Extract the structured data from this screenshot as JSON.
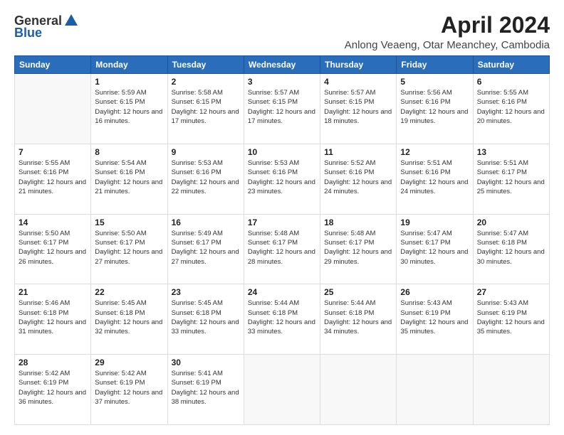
{
  "header": {
    "logo_general": "General",
    "logo_blue": "Blue",
    "month": "April 2024",
    "location": "Anlong Veaeng, Otar Meanchey, Cambodia"
  },
  "days_of_week": [
    "Sunday",
    "Monday",
    "Tuesday",
    "Wednesday",
    "Thursday",
    "Friday",
    "Saturday"
  ],
  "weeks": [
    [
      {
        "day": "",
        "sunrise": "",
        "sunset": "",
        "daylight": ""
      },
      {
        "day": "1",
        "sunrise": "Sunrise: 5:59 AM",
        "sunset": "Sunset: 6:15 PM",
        "daylight": "Daylight: 12 hours and 16 minutes."
      },
      {
        "day": "2",
        "sunrise": "Sunrise: 5:58 AM",
        "sunset": "Sunset: 6:15 PM",
        "daylight": "Daylight: 12 hours and 17 minutes."
      },
      {
        "day": "3",
        "sunrise": "Sunrise: 5:57 AM",
        "sunset": "Sunset: 6:15 PM",
        "daylight": "Daylight: 12 hours and 17 minutes."
      },
      {
        "day": "4",
        "sunrise": "Sunrise: 5:57 AM",
        "sunset": "Sunset: 6:15 PM",
        "daylight": "Daylight: 12 hours and 18 minutes."
      },
      {
        "day": "5",
        "sunrise": "Sunrise: 5:56 AM",
        "sunset": "Sunset: 6:16 PM",
        "daylight": "Daylight: 12 hours and 19 minutes."
      },
      {
        "day": "6",
        "sunrise": "Sunrise: 5:55 AM",
        "sunset": "Sunset: 6:16 PM",
        "daylight": "Daylight: 12 hours and 20 minutes."
      }
    ],
    [
      {
        "day": "7",
        "sunrise": "Sunrise: 5:55 AM",
        "sunset": "Sunset: 6:16 PM",
        "daylight": "Daylight: 12 hours and 21 minutes."
      },
      {
        "day": "8",
        "sunrise": "Sunrise: 5:54 AM",
        "sunset": "Sunset: 6:16 PM",
        "daylight": "Daylight: 12 hours and 21 minutes."
      },
      {
        "day": "9",
        "sunrise": "Sunrise: 5:53 AM",
        "sunset": "Sunset: 6:16 PM",
        "daylight": "Daylight: 12 hours and 22 minutes."
      },
      {
        "day": "10",
        "sunrise": "Sunrise: 5:53 AM",
        "sunset": "Sunset: 6:16 PM",
        "daylight": "Daylight: 12 hours and 23 minutes."
      },
      {
        "day": "11",
        "sunrise": "Sunrise: 5:52 AM",
        "sunset": "Sunset: 6:16 PM",
        "daylight": "Daylight: 12 hours and 24 minutes."
      },
      {
        "day": "12",
        "sunrise": "Sunrise: 5:51 AM",
        "sunset": "Sunset: 6:16 PM",
        "daylight": "Daylight: 12 hours and 24 minutes."
      },
      {
        "day": "13",
        "sunrise": "Sunrise: 5:51 AM",
        "sunset": "Sunset: 6:17 PM",
        "daylight": "Daylight: 12 hours and 25 minutes."
      }
    ],
    [
      {
        "day": "14",
        "sunrise": "Sunrise: 5:50 AM",
        "sunset": "Sunset: 6:17 PM",
        "daylight": "Daylight: 12 hours and 26 minutes."
      },
      {
        "day": "15",
        "sunrise": "Sunrise: 5:50 AM",
        "sunset": "Sunset: 6:17 PM",
        "daylight": "Daylight: 12 hours and 27 minutes."
      },
      {
        "day": "16",
        "sunrise": "Sunrise: 5:49 AM",
        "sunset": "Sunset: 6:17 PM",
        "daylight": "Daylight: 12 hours and 27 minutes."
      },
      {
        "day": "17",
        "sunrise": "Sunrise: 5:48 AM",
        "sunset": "Sunset: 6:17 PM",
        "daylight": "Daylight: 12 hours and 28 minutes."
      },
      {
        "day": "18",
        "sunrise": "Sunrise: 5:48 AM",
        "sunset": "Sunset: 6:17 PM",
        "daylight": "Daylight: 12 hours and 29 minutes."
      },
      {
        "day": "19",
        "sunrise": "Sunrise: 5:47 AM",
        "sunset": "Sunset: 6:17 PM",
        "daylight": "Daylight: 12 hours and 30 minutes."
      },
      {
        "day": "20",
        "sunrise": "Sunrise: 5:47 AM",
        "sunset": "Sunset: 6:18 PM",
        "daylight": "Daylight: 12 hours and 30 minutes."
      }
    ],
    [
      {
        "day": "21",
        "sunrise": "Sunrise: 5:46 AM",
        "sunset": "Sunset: 6:18 PM",
        "daylight": "Daylight: 12 hours and 31 minutes."
      },
      {
        "day": "22",
        "sunrise": "Sunrise: 5:45 AM",
        "sunset": "Sunset: 6:18 PM",
        "daylight": "Daylight: 12 hours and 32 minutes."
      },
      {
        "day": "23",
        "sunrise": "Sunrise: 5:45 AM",
        "sunset": "Sunset: 6:18 PM",
        "daylight": "Daylight: 12 hours and 33 minutes."
      },
      {
        "day": "24",
        "sunrise": "Sunrise: 5:44 AM",
        "sunset": "Sunset: 6:18 PM",
        "daylight": "Daylight: 12 hours and 33 minutes."
      },
      {
        "day": "25",
        "sunrise": "Sunrise: 5:44 AM",
        "sunset": "Sunset: 6:18 PM",
        "daylight": "Daylight: 12 hours and 34 minutes."
      },
      {
        "day": "26",
        "sunrise": "Sunrise: 5:43 AM",
        "sunset": "Sunset: 6:19 PM",
        "daylight": "Daylight: 12 hours and 35 minutes."
      },
      {
        "day": "27",
        "sunrise": "Sunrise: 5:43 AM",
        "sunset": "Sunset: 6:19 PM",
        "daylight": "Daylight: 12 hours and 35 minutes."
      }
    ],
    [
      {
        "day": "28",
        "sunrise": "Sunrise: 5:42 AM",
        "sunset": "Sunset: 6:19 PM",
        "daylight": "Daylight: 12 hours and 36 minutes."
      },
      {
        "day": "29",
        "sunrise": "Sunrise: 5:42 AM",
        "sunset": "Sunset: 6:19 PM",
        "daylight": "Daylight: 12 hours and 37 minutes."
      },
      {
        "day": "30",
        "sunrise": "Sunrise: 5:41 AM",
        "sunset": "Sunset: 6:19 PM",
        "daylight": "Daylight: 12 hours and 38 minutes."
      },
      {
        "day": "",
        "sunrise": "",
        "sunset": "",
        "daylight": ""
      },
      {
        "day": "",
        "sunrise": "",
        "sunset": "",
        "daylight": ""
      },
      {
        "day": "",
        "sunrise": "",
        "sunset": "",
        "daylight": ""
      },
      {
        "day": "",
        "sunrise": "",
        "sunset": "",
        "daylight": ""
      }
    ]
  ]
}
